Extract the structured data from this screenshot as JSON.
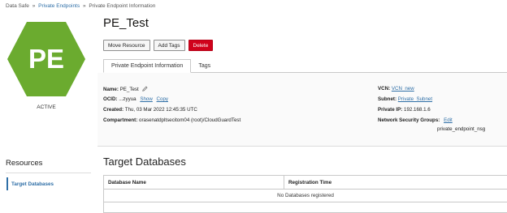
{
  "breadcrumb": {
    "items": [
      "Data Safe",
      "Private Endpoints",
      "Private Endpoint Information"
    ],
    "separator": "»"
  },
  "badge": {
    "text": "PE",
    "color": "#6bab2f",
    "status": "ACTIVE"
  },
  "title": "PE_Test",
  "actions": {
    "move": "Move Resource",
    "add_tags": "Add Tags",
    "delete": "Delete"
  },
  "tabs": [
    "Private Endpoint Information",
    "Tags"
  ],
  "info": {
    "name_label": "Name:",
    "name_value": "PE_Test",
    "ocid_label": "OCID:",
    "ocid_value": "...zyyua",
    "ocid_show": "Show",
    "ocid_copy": "Copy",
    "created_label": "Created:",
    "created_value": "Thu, 03 Mar 2022 12:45:35 UTC",
    "compartment_label": "Compartment:",
    "compartment_value": "orasenatdpltsecitom04 (root)/CloudGuardTest",
    "vcn_label": "VCN:",
    "vcn_value": "VCN_new",
    "subnet_label": "Subnet:",
    "subnet_value": "Private_Subnet",
    "ip_label": "Private IP:",
    "ip_value": "192.168.1.6",
    "nsg_label": "Network Security Groups:",
    "nsg_edit": "Edit",
    "nsg_value": "private_endpoint_nsg"
  },
  "resources": {
    "title": "Resources",
    "items": [
      "Target Databases"
    ]
  },
  "targets": {
    "title": "Target Databases",
    "columns": [
      "Database Name",
      "Registration Time"
    ],
    "empty": "No Databases registered"
  },
  "colors": {
    "accent": "#2f6fa7",
    "danger": "#d0021b",
    "badge": "#6bab2f"
  }
}
